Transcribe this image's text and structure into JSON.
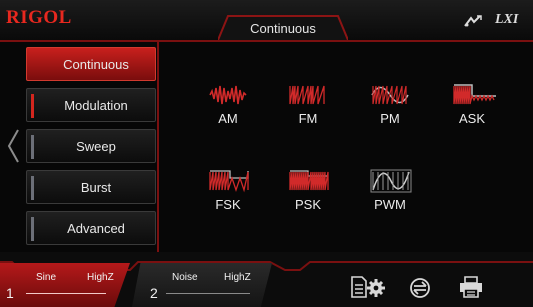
{
  "header": {
    "logo": "RIGOL",
    "title": "Continuous",
    "lxi_label": "LXI",
    "icons": [
      "network-icon",
      "lxi-icon"
    ]
  },
  "menu": {
    "items": [
      {
        "label": "Continuous",
        "state": "active"
      },
      {
        "label": "Modulation",
        "state": "highlighted"
      },
      {
        "label": "Sweep",
        "state": "normal"
      },
      {
        "label": "Burst",
        "state": "normal"
      },
      {
        "label": "Advanced",
        "state": "normal"
      }
    ]
  },
  "modulations": {
    "row1": [
      "AM",
      "FM",
      "PM",
      "ASK"
    ],
    "row2": [
      "FSK",
      "PSK",
      "PWM"
    ]
  },
  "footer": {
    "ch1": {
      "number": "1",
      "waveform": "Sine",
      "impedance": "HighZ"
    },
    "ch2": {
      "number": "2",
      "waveform": "Noise",
      "impedance": "HighZ"
    },
    "icons": [
      "document-icon",
      "settings-gear-icon",
      "sync-icon",
      "print-icon"
    ]
  },
  "colors": {
    "accent": "#c8201d",
    "dark_red": "#7a1010",
    "text": "#ececec",
    "background": "#070707",
    "waveform_red": "#d12a2a",
    "waveform_gray": "#bdbdbd"
  }
}
